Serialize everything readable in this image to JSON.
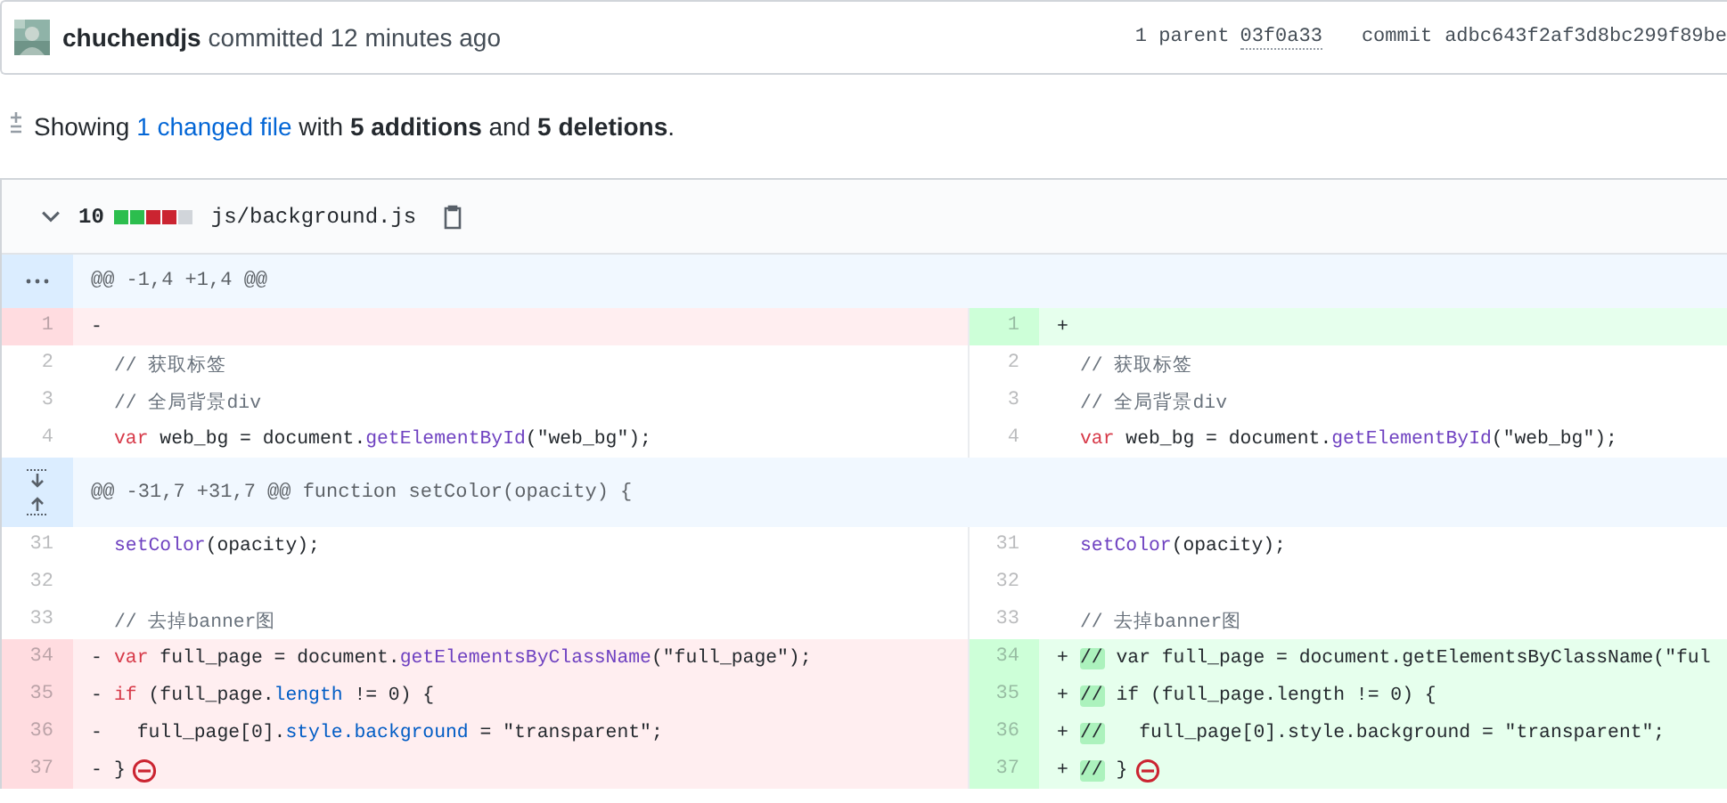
{
  "commit_header": {
    "author": "chuchendjs",
    "action": "committed 12 minutes ago",
    "parent_label": "1 parent",
    "parent_sha": "03f0a33",
    "commit_label": "commit",
    "commit_sha": "adbc643f2af3d8bc299f89be"
  },
  "summary": {
    "before": "Showing",
    "link": "1 changed file",
    "after": "with **5 additions** and **5 deletions**."
  },
  "file": {
    "expanded": true,
    "change_count": "10",
    "diffstat": [
      {
        "color": "#2cbe4e"
      },
      {
        "color": "#2cbe4e"
      },
      {
        "color": "#cb2431"
      },
      {
        "color": "#cb2431"
      },
      {
        "color": "#d1d5da"
      }
    ],
    "path": "js/background.js",
    "rows": [
      {
        "kind": "hunk",
        "expand_up": false,
        "expand_down": false,
        "text": "@@ -1,4 +1,4 @@"
      },
      {
        "kind": "line",
        "left": {
          "num": "1",
          "kind": "deleted",
          "sign": "-"
        },
        "right": {
          "num": "1",
          "kind": "added",
          "sign": "+"
        }
      },
      {
        "kind": "line",
        "left": {
          "num": "2",
          "kind": "context",
          "code": [
            {
              "kind": "comment",
              "text": "// 获取标签"
            }
          ]
        },
        "right": {
          "num": "2",
          "kind": "context",
          "code": [
            {
              "kind": "comment",
              "text": "// 获取标签"
            }
          ]
        }
      },
      {
        "kind": "line",
        "left": {
          "num": "3",
          "kind": "context",
          "code": [
            {
              "kind": "comment",
              "text": "// 全局背景div"
            }
          ]
        },
        "right": {
          "num": "3",
          "kind": "context",
          "code": [
            {
              "kind": "comment",
              "text": "// 全局背景div"
            }
          ]
        }
      },
      {
        "kind": "line",
        "left": {
          "num": "4",
          "kind": "context",
          "code": [
            {
              "kind": "keyword",
              "text": "var"
            },
            {
              "kind": "plain",
              "text": " web_bg = document."
            },
            {
              "kind": "function",
              "text": "getElementById"
            },
            {
              "kind": "plain",
              "text": "(\"web_bg\");"
            }
          ]
        },
        "right": {
          "num": "4",
          "kind": "context",
          "code": [
            {
              "kind": "keyword",
              "text": "var"
            },
            {
              "kind": "plain",
              "text": " web_bg = document."
            },
            {
              "kind": "function",
              "text": "getElementById"
            },
            {
              "kind": "plain",
              "text": "(\"web_bg\");"
            }
          ]
        }
      },
      {
        "kind": "hunk",
        "expand_up": true,
        "expand_down": true,
        "text": "@@ -31,7 +31,7 @@ function setColor(opacity) {"
      },
      {
        "kind": "line",
        "left": {
          "num": "31",
          "kind": "context",
          "code": [
            {
              "kind": "function",
              "text": "setColor"
            },
            {
              "kind": "plain",
              "text": "(opacity);"
            }
          ]
        },
        "right": {
          "num": "31",
          "kind": "context",
          "code": [
            {
              "kind": "function",
              "text": "setColor"
            },
            {
              "kind": "plain",
              "text": "(opacity);"
            }
          ]
        }
      },
      {
        "kind": "line",
        "left": {
          "num": "32",
          "kind": "context"
        },
        "right": {
          "num": "32",
          "kind": "context"
        }
      },
      {
        "kind": "line",
        "left": {
          "num": "33",
          "kind": "context",
          "code": [
            {
              "kind": "comment",
              "text": "// 去掉banner图"
            }
          ]
        },
        "right": {
          "num": "33",
          "kind": "context",
          "code": [
            {
              "kind": "comment",
              "text": "// 去掉banner图"
            }
          ]
        }
      },
      {
        "kind": "line",
        "left": {
          "num": "34",
          "kind": "deleted",
          "sign": "-",
          "code": [
            {
              "kind": "keyword",
              "text": "var"
            },
            {
              "kind": "plain",
              "text": " full_page = document."
            },
            {
              "kind": "function",
              "text": "getElementsByClassName"
            },
            {
              "kind": "plain",
              "text": "(\"full_page\");"
            }
          ]
        },
        "right": {
          "num": "34",
          "kind": "added",
          "sign": "+",
          "code": [
            {
              "kind": "mark",
              "text": "//"
            },
            {
              "kind": "plain",
              "text": " var full_page = document.getElementsByClassName(\"ful"
            }
          ]
        }
      },
      {
        "kind": "line",
        "left": {
          "num": "35",
          "kind": "deleted",
          "sign": "-",
          "code": [
            {
              "kind": "keyword",
              "text": "if"
            },
            {
              "kind": "plain",
              "text": " (full_page."
            },
            {
              "kind": "property",
              "text": "length"
            },
            {
              "kind": "plain",
              "text": " != 0) {"
            }
          ]
        },
        "right": {
          "num": "35",
          "kind": "added",
          "sign": "+",
          "code": [
            {
              "kind": "mark",
              "text": "//"
            },
            {
              "kind": "plain",
              "text": " if (full_page.length != 0) {"
            }
          ]
        }
      },
      {
        "kind": "line",
        "left": {
          "num": "36",
          "kind": "deleted",
          "sign": "-",
          "code": [
            {
              "kind": "plain",
              "text": "  full_page[0]."
            },
            {
              "kind": "property",
              "text": "style.background"
            },
            {
              "kind": "plain",
              "text": " = \"transparent\";"
            }
          ]
        },
        "right": {
          "num": "36",
          "kind": "added",
          "sign": "+",
          "code": [
            {
              "kind": "mark",
              "text": "//"
            },
            {
              "kind": "plain",
              "text": "   full_page[0].style.background = \"transparent\";"
            }
          ]
        }
      },
      {
        "kind": "line",
        "left": {
          "num": "37",
          "kind": "deleted",
          "sign": "-",
          "no_newline": true,
          "code": [
            {
              "kind": "plain",
              "text": "}"
            }
          ]
        },
        "right": {
          "num": "37",
          "kind": "added",
          "sign": "+",
          "no_newline": true,
          "code": [
            {
              "kind": "mark",
              "text": "//"
            },
            {
              "kind": "plain",
              "text": " }"
            }
          ]
        }
      }
    ]
  }
}
